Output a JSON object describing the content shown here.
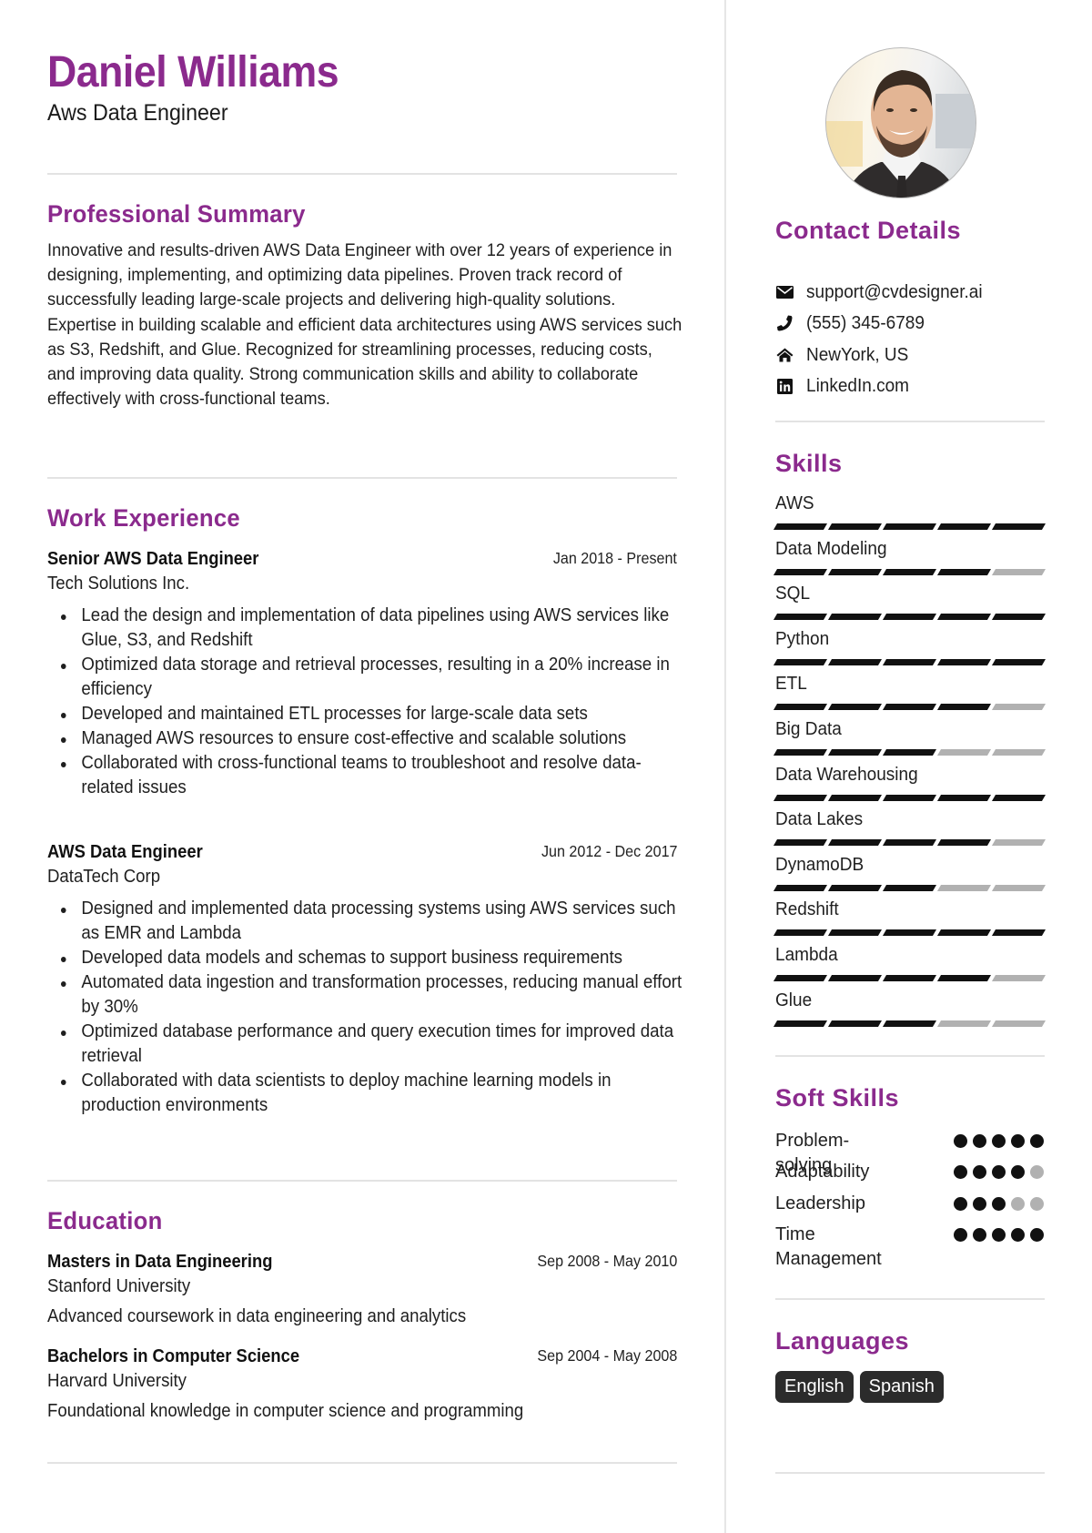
{
  "header": {
    "name": "Daniel Williams",
    "title": "Aws Data Engineer"
  },
  "colors": {
    "accent": "#8b2a8d",
    "text": "#1f1f1f",
    "bar_on": "#111111",
    "bar_off": "#b1b1b1",
    "badge_bg": "#2b2b2b",
    "divider": "#e3e3e3"
  },
  "summary": {
    "heading": "Professional Summary",
    "text": "Innovative and results-driven AWS Data Engineer with over 12 years of experience in designing, implementing, and optimizing data pipelines. Proven track record of successfully leading large-scale projects and delivering high-quality solutions. Expertise in building scalable and efficient data architectures using AWS services such as S3, Redshift, and Glue. Recognized for streamlining processes, reducing costs, and improving data quality. Strong communication skills and ability to collaborate effectively with cross-functional teams."
  },
  "experience": {
    "heading": "Work Experience",
    "jobs": [
      {
        "title": "Senior AWS Data Engineer",
        "company": "Tech Solutions Inc.",
        "dates": "Jan 2018 - Present",
        "bullets": [
          "Lead the design and implementation of data pipelines using AWS services like Glue, S3, and Redshift",
          "Optimized data storage and retrieval processes, resulting in a 20% increase in efficiency",
          "Developed and maintained ETL processes for large-scale data sets",
          "Managed AWS resources to ensure cost-effective and scalable solutions",
          "Collaborated with cross-functional teams to troubleshoot and resolve data-related issues"
        ]
      },
      {
        "title": "AWS Data Engineer",
        "company": "DataTech Corp",
        "dates": "Jun 2012 - Dec 2017",
        "bullets": [
          "Designed and implemented data processing systems using AWS services such as EMR and Lambda",
          "Developed data models and schemas to support business requirements",
          "Automated data ingestion and transformation processes, reducing manual effort by 30%",
          "Optimized database performance and query execution times for improved data retrieval",
          "Collaborated with data scientists to deploy machine learning models in production environments"
        ]
      }
    ]
  },
  "education": {
    "heading": "Education",
    "items": [
      {
        "degree": "Masters in Data Engineering",
        "school": "Stanford University",
        "dates": "Sep 2008 - May 2010",
        "description": "Advanced coursework in data engineering and analytics"
      },
      {
        "degree": "Bachelors in Computer Science",
        "school": "Harvard University",
        "dates": "Sep 2004 - May 2008",
        "description": "Foundational knowledge in computer science and programming"
      }
    ]
  },
  "contact": {
    "heading": "Contact Details",
    "items": [
      {
        "icon": "envelope-icon",
        "text": "support@cvdesigner.ai"
      },
      {
        "icon": "phone-icon",
        "text": "(555) 345-6789"
      },
      {
        "icon": "home-icon",
        "text": "NewYork, US"
      },
      {
        "icon": "linkedin-icon",
        "text": "LinkedIn.com"
      }
    ]
  },
  "skills": {
    "heading": "Skills",
    "max_level": 5,
    "items": [
      {
        "name": "AWS",
        "level": 5
      },
      {
        "name": "Data Modeling",
        "level": 4
      },
      {
        "name": "SQL",
        "level": 5
      },
      {
        "name": "Python",
        "level": 5
      },
      {
        "name": "ETL",
        "level": 4
      },
      {
        "name": "Big Data",
        "level": 3
      },
      {
        "name": "Data Warehousing",
        "level": 5
      },
      {
        "name": "Data Lakes",
        "level": 4
      },
      {
        "name": "DynamoDB",
        "level": 3
      },
      {
        "name": "Redshift",
        "level": 5
      },
      {
        "name": "Lambda",
        "level": 4
      },
      {
        "name": "Glue",
        "level": 3
      }
    ]
  },
  "soft_skills": {
    "heading": "Soft Skills",
    "max_level": 5,
    "items": [
      {
        "name": "Problem-solving",
        "level": 5
      },
      {
        "name": "Adaptability",
        "level": 4
      },
      {
        "name": "Leadership",
        "level": 3
      },
      {
        "name": "Time Management",
        "level": 5
      }
    ]
  },
  "languages": {
    "heading": "Languages",
    "items": [
      "English",
      "Spanish"
    ]
  }
}
